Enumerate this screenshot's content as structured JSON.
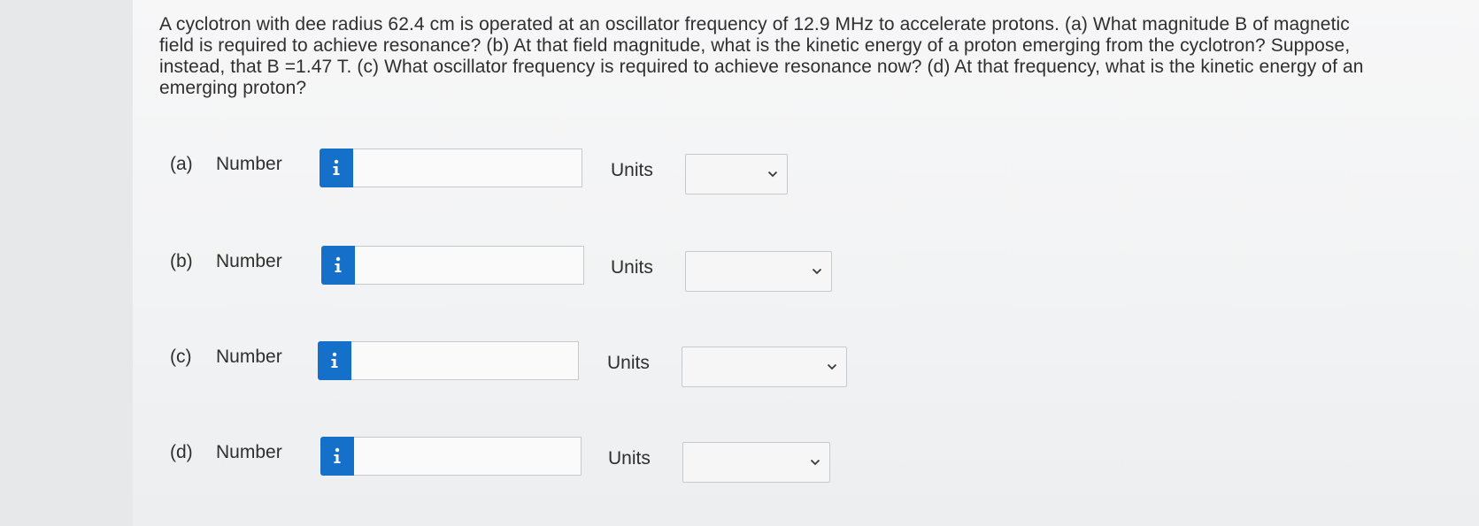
{
  "question": {
    "text": "A cyclotron with dee radius 62.4 cm is operated at an oscillator frequency of 12.9 MHz to accelerate protons. (a) What magnitude B of magnetic field is required to achieve resonance? (b) At that field magnitude, what is the kinetic energy of a proton emerging from the cyclotron? Suppose, instead, that B =1.47 T. (c) What oscillator frequency is required to achieve resonance now? (d) At that frequency, what is the kinetic energy of an emerging proton?"
  },
  "parts": [
    {
      "label": "(a)",
      "number_label": "Number",
      "number_value": "",
      "units_label": "Units",
      "units_value": ""
    },
    {
      "label": "(b)",
      "number_label": "Number",
      "number_value": "",
      "units_label": "Units",
      "units_value": ""
    },
    {
      "label": "(c)",
      "number_label": "Number",
      "number_value": "",
      "units_label": "Units",
      "units_value": ""
    },
    {
      "label": "(d)",
      "number_label": "Number",
      "number_value": "",
      "units_label": "Units",
      "units_value": ""
    }
  ],
  "icons": {
    "info": "info-icon",
    "dropdown": "chevron-down-icon"
  },
  "colors": {
    "info_button": "#1470c8"
  }
}
